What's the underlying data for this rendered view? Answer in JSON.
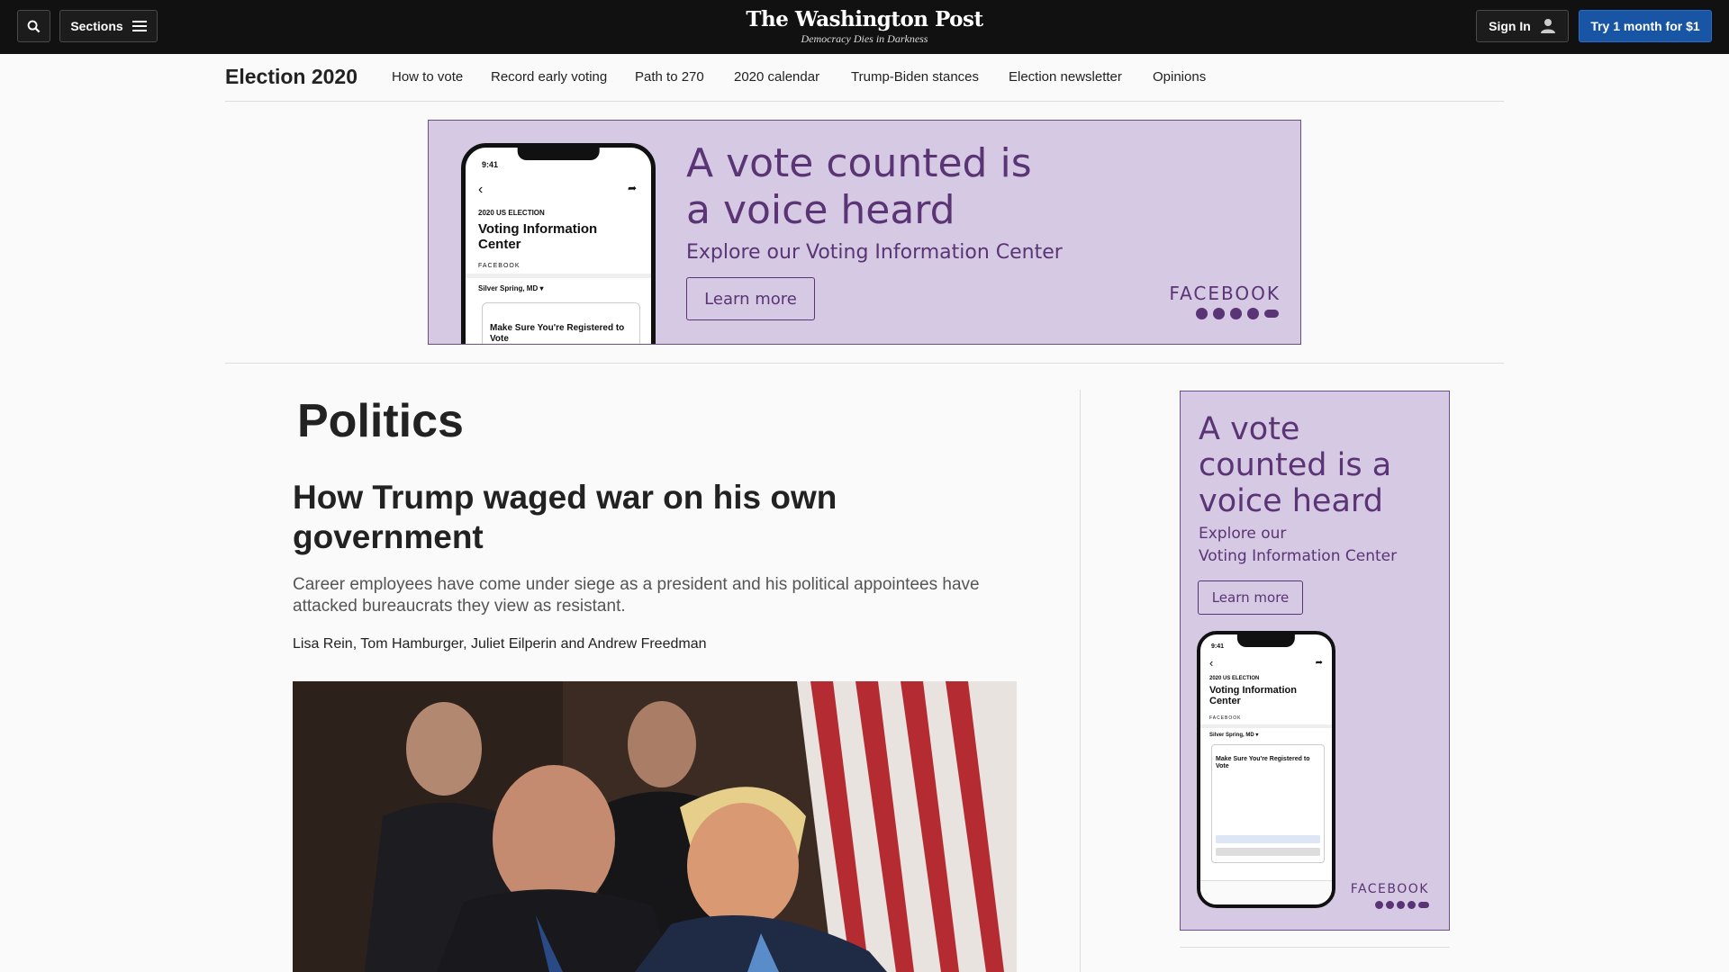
{
  "header": {
    "sections_label": "Sections",
    "logo": "The Washington Post",
    "tagline": "Democracy Dies in Darkness",
    "signin_label": "Sign In",
    "subscribe_label": "Try 1 month for $1"
  },
  "nav": {
    "title": "Election 2020",
    "links": [
      "How to vote",
      "Record early voting",
      "Path to 270",
      "2020 calendar",
      "Trump-Biden stances",
      "Election newsletter",
      "Opinions"
    ]
  },
  "banner_ad": {
    "headline": "A vote counted is a voice heard",
    "subtitle": "Explore our Voting Information Center",
    "cta": "Learn more",
    "brand": "FACEBOOK",
    "phone": {
      "time": "9:41",
      "election": "2020 US ELECTION",
      "title": "Voting Information Center",
      "brand": "FACEBOOK",
      "location": "Silver Spring, MD ▾",
      "card_title": "Make Sure You're Registered to Vote"
    }
  },
  "article": {
    "section": "Politics",
    "headline": "How Trump waged war on his own government",
    "dek": "Career employees have come under siege as a president and his political appointees have attacked bureaucrats they view as resistant.",
    "byline": "Lisa Rein, Tom Hamburger, Juliet Eilperin and Andrew Freedman"
  },
  "side_ad": {
    "headline": "A vote counted is a voice heard",
    "subtitle_line1": "Explore our",
    "subtitle_line2": "Voting Information Center",
    "cta": "Learn more",
    "brand": "FACEBOOK",
    "phone": {
      "time": "9:41",
      "election": "2020 US ELECTION",
      "title": "Voting Information Center",
      "brand": "FACEBOOK",
      "location": "Silver Spring, MD ▾",
      "card_title": "Make Sure You're Registered to Vote"
    }
  },
  "colors": {
    "topbar": "#111111",
    "subscribe": "#1955a5",
    "ad_bg": "#d5c9e3",
    "ad_text": "#5a3474"
  }
}
